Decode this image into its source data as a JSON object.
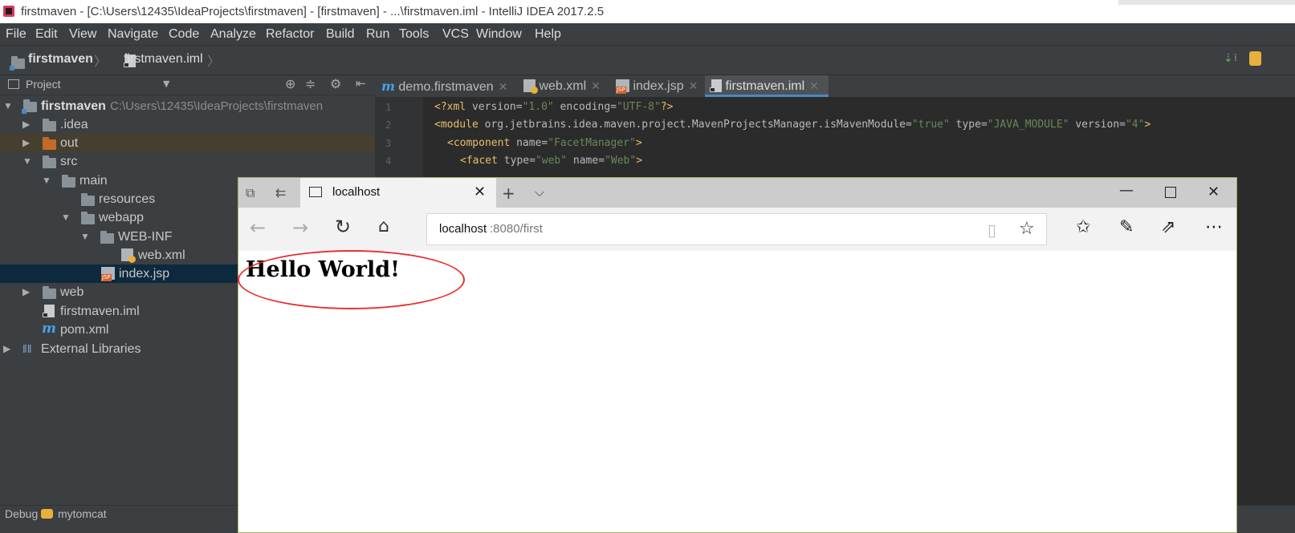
{
  "window": {
    "title": "firstmaven - [C:\\Users\\12435\\IdeaProjects\\firstmaven] - [firstmaven] - ...\\firstmaven.iml - IntelliJ IDEA 2017.2.5"
  },
  "menu": [
    "File",
    "Edit",
    "View",
    "Navigate",
    "Code",
    "Analyze",
    "Refactor",
    "Build",
    "Run",
    "Tools",
    "VCS",
    "Window",
    "Help"
  ],
  "breadcrumb": {
    "project": "firstmaven",
    "file": "firstmaven.iml"
  },
  "project_panel": {
    "title": "Project",
    "tree": [
      {
        "label": "firstmaven",
        "path": "C:\\Users\\12435\\IdeaProjects\\firstmaven"
      },
      {
        "label": ".idea"
      },
      {
        "label": "out"
      },
      {
        "label": "src"
      },
      {
        "label": "main"
      },
      {
        "label": "resources"
      },
      {
        "label": "webapp"
      },
      {
        "label": "WEB-INF"
      },
      {
        "label": "web.xml"
      },
      {
        "label": "index.jsp"
      },
      {
        "label": "web"
      },
      {
        "label": "firstmaven.iml"
      },
      {
        "label": "pom.xml"
      },
      {
        "label": "External Libraries"
      }
    ]
  },
  "editor": {
    "tabs": [
      {
        "label": "demo.firstmaven"
      },
      {
        "label": "web.xml"
      },
      {
        "label": "index.jsp"
      },
      {
        "label": "firstmaven.iml"
      }
    ],
    "lines": [
      {
        "n": "1",
        "p1": "<?xml ",
        "a1": "version=",
        "v1": "\"1.0\"",
        "a2": " encoding=",
        "v2": "\"UTF-8\"",
        "p2": "?>"
      },
      {
        "n": "2",
        "p1": "<module ",
        "a1": "org.jetbrains.idea.maven.project.MavenProjectsManager.isMavenModule=",
        "v1": "\"true\"",
        "a2": " type=",
        "v2": "\"JAVA_MODULE\"",
        "a3": " version=",
        "v3": "\"4\"",
        "p2": ">"
      },
      {
        "n": "3",
        "p1": "<component ",
        "a1": "name=",
        "v1": "\"FacetManager\"",
        "p2": ">"
      },
      {
        "n": "4",
        "p1": "<facet ",
        "a1": "type=",
        "v1": "\"web\"",
        "a2": " name=",
        "v2": "\"Web\"",
        "p2": ">"
      }
    ]
  },
  "statusbar": {
    "label": "Debug",
    "config": "mytomcat"
  },
  "browser": {
    "tab_title": "localhost",
    "url_host": "localhost",
    "url_rest": ":8080/first",
    "content": "Hello World!"
  }
}
